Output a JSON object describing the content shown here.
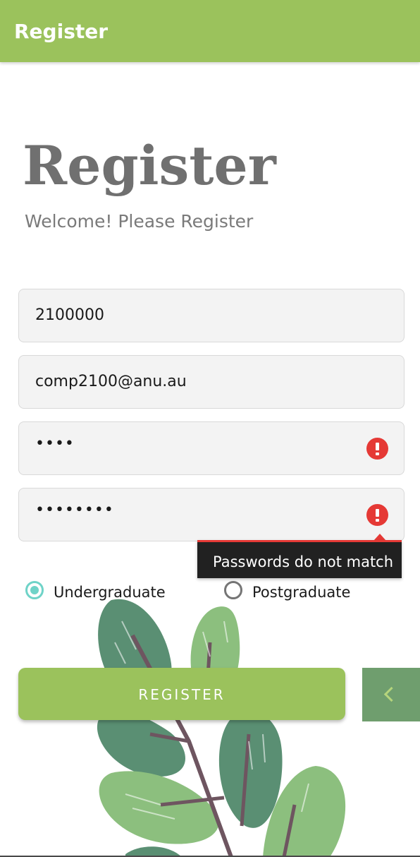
{
  "app_bar": {
    "title": "Register"
  },
  "header": {
    "title": "Register",
    "subtitle": "Welcome! Please Register"
  },
  "form": {
    "uid_value": "2100000",
    "email_value": "comp2100@anu.au",
    "password_mask": "••••",
    "confirm_password_mask": "••••••••",
    "error_message": "Passwords do not match",
    "degree_options": [
      {
        "label": "Undergraduate",
        "selected": true
      },
      {
        "label": "Postgraduate",
        "selected": false
      }
    ]
  },
  "actions": {
    "register_label": "REGISTER",
    "back_icon": "chevron-left-icon"
  },
  "colors": {
    "brand_green": "#9BC25C",
    "back_button": "#6F9E6E",
    "error_red": "#E53935",
    "radio_accent": "#6FD3C8"
  }
}
